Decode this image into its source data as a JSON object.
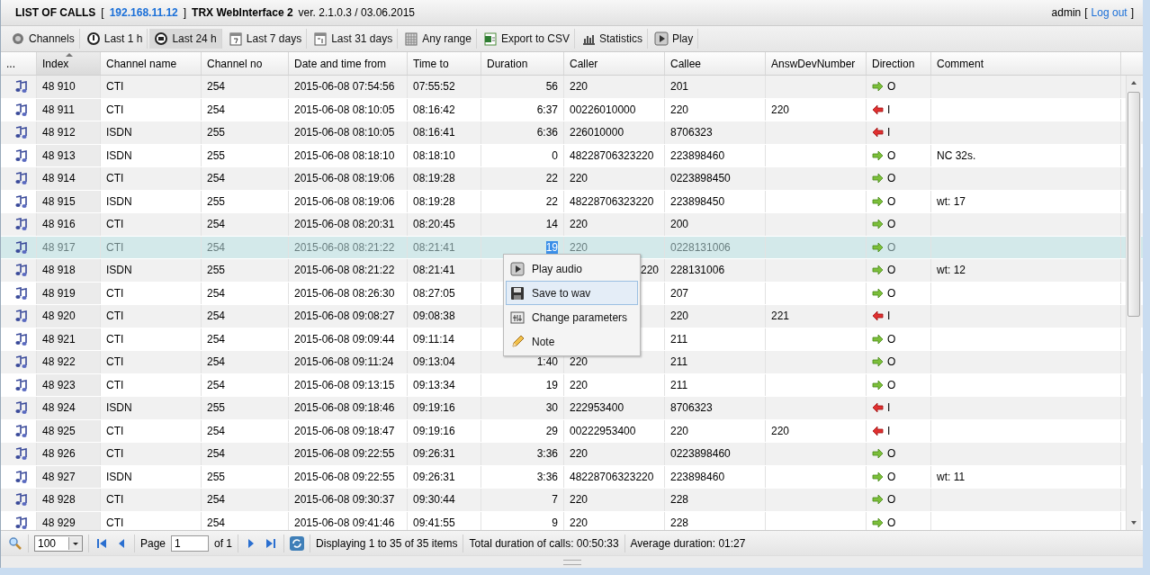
{
  "header": {
    "title": "LIST OF CALLS",
    "host_open": "[",
    "host": "192.168.11.12",
    "host_close": "]",
    "app_name": "TRX WebInterface 2",
    "version": "ver. 2.1.0.3 / 03.06.2015",
    "user": "admin",
    "logout_open": "[",
    "logout": "Log out",
    "logout_close": "]"
  },
  "toolbar": [
    {
      "label": "Channels",
      "selected": false
    },
    {
      "label": "Last 1 h",
      "selected": false
    },
    {
      "label": "Last 24 h",
      "selected": true
    },
    {
      "label": "Last 7 days",
      "selected": false
    },
    {
      "label": "Last 31 days",
      "selected": false
    },
    {
      "label": "Any range",
      "selected": false
    },
    {
      "label": "Export to CSV",
      "selected": false
    },
    {
      "label": "Statistics",
      "selected": false
    },
    {
      "label": "Play",
      "selected": false
    }
  ],
  "table": {
    "columns": [
      {
        "label": "...",
        "sorted": false
      },
      {
        "label": "Index",
        "sorted": true
      },
      {
        "label": "Channel name",
        "sorted": false
      },
      {
        "label": "Channel no",
        "sorted": false
      },
      {
        "label": "Date and time from",
        "sorted": false
      },
      {
        "label": "Time to",
        "sorted": false
      },
      {
        "label": "Duration",
        "sorted": false
      },
      {
        "label": "Caller",
        "sorted": false
      },
      {
        "label": "Callee",
        "sorted": false
      },
      {
        "label": "AnswDevNumber",
        "sorted": false
      },
      {
        "label": "Direction",
        "sorted": false
      },
      {
        "label": "Comment",
        "sorted": false
      }
    ],
    "rows": [
      {
        "index": "48 910",
        "channel": "CTI",
        "channel_no": "254",
        "from": "2015-06-08 07:54:56",
        "to": "07:55:52",
        "duration": "56",
        "caller": "220",
        "callee": "201",
        "direction": {
          "kind": "out",
          "label": "O"
        },
        "selected": false
      },
      {
        "index": "48 911",
        "channel": "CTI",
        "channel_no": "254",
        "from": "2015-06-08 08:10:05",
        "to": "08:16:42",
        "duration": "6:37",
        "caller": "00226010000",
        "callee": "220",
        "answ_dev": "220",
        "direction": {
          "kind": "in",
          "label": "I"
        },
        "selected": false
      },
      {
        "index": "48 912",
        "channel": "ISDN",
        "channel_no": "255",
        "from": "2015-06-08 08:10:05",
        "to": "08:16:41",
        "duration": "6:36",
        "caller": "226010000",
        "callee": "8706323",
        "direction": {
          "kind": "in",
          "label": "I"
        },
        "selected": false
      },
      {
        "index": "48 913",
        "channel": "ISDN",
        "channel_no": "255",
        "from": "2015-06-08 08:18:10",
        "to": "08:18:10",
        "duration": "0",
        "caller": "48228706323220",
        "callee": "223898460",
        "direction": {
          "kind": "out",
          "label": "O"
        },
        "comment": "NC 32s.",
        "selected": false
      },
      {
        "index": "48 914",
        "channel": "CTI",
        "channel_no": "254",
        "from": "2015-06-08 08:19:06",
        "to": "08:19:28",
        "duration": "22",
        "caller": "220",
        "callee": "0223898450",
        "direction": {
          "kind": "out",
          "label": "O"
        },
        "selected": false
      },
      {
        "index": "48 915",
        "channel": "ISDN",
        "channel_no": "255",
        "from": "2015-06-08 08:19:06",
        "to": "08:19:28",
        "duration": "22",
        "caller": "48228706323220",
        "callee": "223898450",
        "direction": {
          "kind": "out",
          "label": "O"
        },
        "comment": "wt: 17",
        "selected": false
      },
      {
        "index": "48 916",
        "channel": "CTI",
        "channel_no": "254",
        "from": "2015-06-08 08:20:31",
        "to": "08:20:45",
        "duration": "14",
        "caller": "220",
        "callee": "200",
        "direction": {
          "kind": "out",
          "label": "O"
        },
        "selected": false
      },
      {
        "index": "48 917",
        "channel": "CTI",
        "channel_no": "254",
        "from": "2015-06-08 08:21:22",
        "to": "08:21:41",
        "duration": "19",
        "caller": "220",
        "callee": "0228131006",
        "direction": {
          "kind": "out",
          "label": "O"
        },
        "selected": true
      },
      {
        "index": "48 918",
        "channel": "ISDN",
        "channel_no": "255",
        "from": "2015-06-08 08:21:22",
        "to": "08:21:41",
        "caller": "220",
        "caller_clipped": true,
        "callee": "228131006",
        "direction": {
          "kind": "out",
          "label": "O"
        },
        "comment": "wt: 12",
        "selected": false
      },
      {
        "index": "48 919",
        "channel": "CTI",
        "channel_no": "254",
        "from": "2015-06-08 08:26:30",
        "to": "08:27:05",
        "callee": "207",
        "direction": {
          "kind": "out",
          "label": "O"
        },
        "selected": false
      },
      {
        "index": "48 920",
        "channel": "CTI",
        "channel_no": "254",
        "from": "2015-06-08 09:08:27",
        "to": "09:08:38",
        "callee": "220",
        "answ_dev": "221",
        "direction": {
          "kind": "in",
          "label": "I"
        },
        "selected": false
      },
      {
        "index": "48 921",
        "channel": "CTI",
        "channel_no": "254",
        "from": "2015-06-08 09:09:44",
        "to": "09:11:14",
        "callee": "211",
        "direction": {
          "kind": "out",
          "label": "O"
        },
        "selected": false
      },
      {
        "index": "48 922",
        "channel": "CTI",
        "channel_no": "254",
        "from": "2015-06-08 09:11:24",
        "to": "09:13:04",
        "duration": "1:40",
        "caller": "220",
        "callee": "211",
        "direction": {
          "kind": "out",
          "label": "O"
        },
        "selected": false
      },
      {
        "index": "48 923",
        "channel": "CTI",
        "channel_no": "254",
        "from": "2015-06-08 09:13:15",
        "to": "09:13:34",
        "duration": "19",
        "caller": "220",
        "callee": "211",
        "direction": {
          "kind": "out",
          "label": "O"
        },
        "selected": false
      },
      {
        "index": "48 924",
        "channel": "ISDN",
        "channel_no": "255",
        "from": "2015-06-08 09:18:46",
        "to": "09:19:16",
        "duration": "30",
        "caller": "222953400",
        "callee": "8706323",
        "direction": {
          "kind": "in",
          "label": "I"
        },
        "selected": false
      },
      {
        "index": "48 925",
        "channel": "CTI",
        "channel_no": "254",
        "from": "2015-06-08 09:18:47",
        "to": "09:19:16",
        "duration": "29",
        "caller": "00222953400",
        "callee": "220",
        "answ_dev": "220",
        "direction": {
          "kind": "in",
          "label": "I"
        },
        "selected": false
      },
      {
        "index": "48 926",
        "channel": "CTI",
        "channel_no": "254",
        "from": "2015-06-08 09:22:55",
        "to": "09:26:31",
        "duration": "3:36",
        "caller": "220",
        "callee": "0223898460",
        "direction": {
          "kind": "out",
          "label": "O"
        },
        "selected": false
      },
      {
        "index": "48 927",
        "channel": "ISDN",
        "channel_no": "255",
        "from": "2015-06-08 09:22:55",
        "to": "09:26:31",
        "duration": "3:36",
        "caller": "48228706323220",
        "callee": "223898460",
        "direction": {
          "kind": "out",
          "label": "O"
        },
        "comment": "wt: 11",
        "selected": false
      },
      {
        "index": "48 928",
        "channel": "CTI",
        "channel_no": "254",
        "from": "2015-06-08 09:30:37",
        "to": "09:30:44",
        "duration": "7",
        "caller": "220",
        "callee": "228",
        "direction": {
          "kind": "out",
          "label": "O"
        },
        "selected": false
      },
      {
        "index": "48 929",
        "channel": "CTI",
        "channel_no": "254",
        "from": "2015-06-08 09:41:46",
        "to": "09:41:55",
        "duration": "9",
        "caller": "220",
        "callee": "228",
        "direction": {
          "kind": "out",
          "label": "O"
        },
        "selected": false
      }
    ]
  },
  "context_menu": [
    {
      "label": "Play audio",
      "selected": false
    },
    {
      "label": "Save to wav",
      "selected": true
    },
    {
      "label": "Change parameters",
      "selected": false
    },
    {
      "label": "Note",
      "selected": false
    }
  ],
  "footer": {
    "page_size": "100",
    "page_label": "Page",
    "page": "1",
    "of_pages": "of 1",
    "displaying": "Displaying 1 to 35 of 35 items",
    "total": "Total duration of calls: 00:50:33",
    "average": "Average duration: 01:27"
  }
}
